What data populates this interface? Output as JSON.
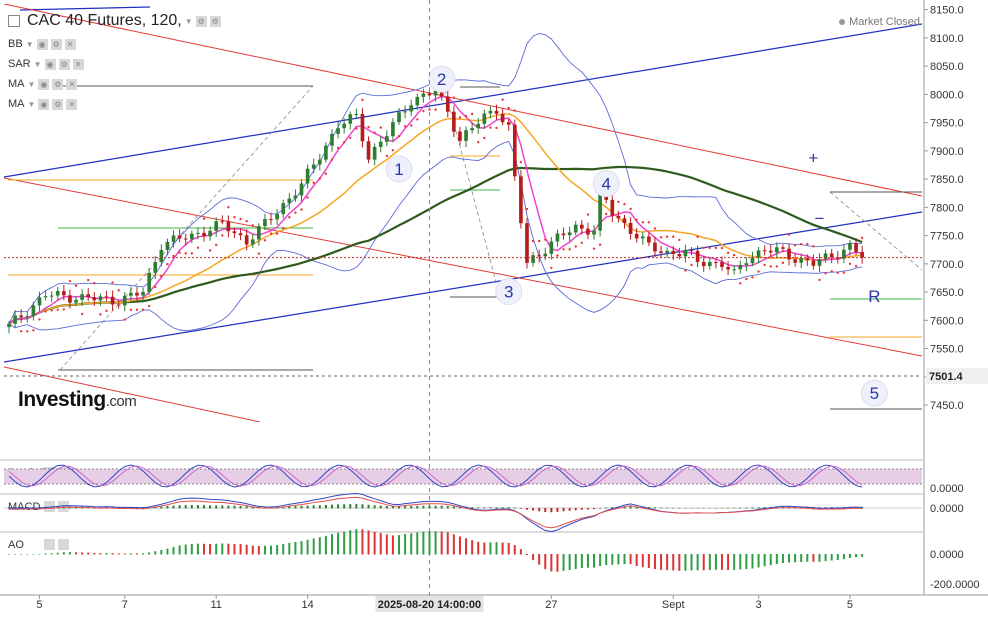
{
  "header": {
    "title": "CAC 40 Futures, 120,",
    "status": "Market Closed",
    "indicators": [
      "BB",
      "SAR",
      "MA",
      "MA"
    ]
  },
  "logo": {
    "main": "Investing",
    "suffix": ".com"
  },
  "colors": {
    "up_candle": "#2e7d32",
    "down_candle": "#b71c1c",
    "channel_blue": "#1f2fbf",
    "channel_red": "#e53935",
    "bollinger": "#5b6bd6",
    "sar": "#e53935",
    "ma_fast": "#ee44cc",
    "ma_mid": "#f5a623",
    "ma_slow": "#2e5a1e",
    "stoch_band": "#e6cfe6",
    "price_line": "#c62828"
  },
  "chart_data": [
    {
      "type": "candlestick",
      "title": "CAC 40 Futures, 120,",
      "ylim": [
        7420,
        8160
      ],
      "y_ticks": [
        "8150.0",
        "8100.0",
        "8050.0",
        "8000.0",
        "7950.0",
        "7900.0",
        "7850.0",
        "7800.0",
        "7750.0",
        "7700.0",
        "7650.0",
        "7600.0",
        "7550.0",
        "7500.0",
        "7450.0"
      ],
      "y_tick_values": [
        8150,
        8100,
        8050,
        8000,
        7950,
        7900,
        7850,
        7800,
        7750,
        7700,
        7650,
        7600,
        7550,
        7500,
        7450
      ],
      "price_label": "7501.4",
      "price_label_value": 7501.4,
      "last_price": 7711,
      "x_ticks": [
        "5",
        "7",
        "11",
        "14",
        "2025-08-20 14:00:00",
        "27",
        "Sept",
        "3",
        "5"
      ],
      "x_tick_bars": [
        5,
        19,
        34,
        49,
        69,
        89,
        109,
        123,
        138
      ],
      "crosshair_label": "2025-08-20 14:00:00",
      "crosshair_bar": 69,
      "wave_labels": [
        {
          "text": "1",
          "bar": 64,
          "price": 7868
        },
        {
          "text": "2",
          "bar": 71,
          "price": 8027
        },
        {
          "text": "3",
          "bar": 82,
          "price": 7651
        },
        {
          "text": "4",
          "bar": 98,
          "price": 7842
        },
        {
          "text": "5",
          "bar": 142,
          "price": 7471
        },
        {
          "text": "+",
          "bar": 132,
          "price": 7888
        },
        {
          "text": "−",
          "bar": 133,
          "price": 7781
        },
        {
          "text": "R",
          "bar": 142,
          "price": 7643
        }
      ],
      "anchors": [
        {
          "bar": 0,
          "price": 7590
        },
        {
          "bar": 6,
          "price": 7645
        },
        {
          "bar": 12,
          "price": 7640
        },
        {
          "bar": 18,
          "price": 7635
        },
        {
          "bar": 22,
          "price": 7650
        },
        {
          "bar": 25,
          "price": 7735
        },
        {
          "bar": 30,
          "price": 7750
        },
        {
          "bar": 35,
          "price": 7770
        },
        {
          "bar": 39,
          "price": 7740
        },
        {
          "bar": 42,
          "price": 7770
        },
        {
          "bar": 48,
          "price": 7840
        },
        {
          "bar": 54,
          "price": 7945
        },
        {
          "bar": 57,
          "price": 7960
        },
        {
          "bar": 59,
          "price": 7890
        },
        {
          "bar": 62,
          "price": 7930
        },
        {
          "bar": 66,
          "price": 7990
        },
        {
          "bar": 70,
          "price": 8005
        },
        {
          "bar": 72,
          "price": 7970
        },
        {
          "bar": 74,
          "price": 7920
        },
        {
          "bar": 78,
          "price": 7960
        },
        {
          "bar": 80,
          "price": 7975
        },
        {
          "bar": 82,
          "price": 7940
        },
        {
          "bar": 83,
          "price": 7850
        },
        {
          "bar": 85,
          "price": 7700
        },
        {
          "bar": 86,
          "price": 7710
        },
        {
          "bar": 90,
          "price": 7745
        },
        {
          "bar": 93,
          "price": 7765
        },
        {
          "bar": 96,
          "price": 7760
        },
        {
          "bar": 97,
          "price": 7830
        },
        {
          "bar": 99,
          "price": 7790
        },
        {
          "bar": 102,
          "price": 7760
        },
        {
          "bar": 105,
          "price": 7730
        },
        {
          "bar": 108,
          "price": 7720
        },
        {
          "bar": 111,
          "price": 7720
        },
        {
          "bar": 113,
          "price": 7705
        },
        {
          "bar": 117,
          "price": 7700
        },
        {
          "bar": 119,
          "price": 7680
        },
        {
          "bar": 121,
          "price": 7710
        },
        {
          "bar": 124,
          "price": 7725
        },
        {
          "bar": 127,
          "price": 7720
        },
        {
          "bar": 129,
          "price": 7710
        },
        {
          "bar": 132,
          "price": 7700
        },
        {
          "bar": 135,
          "price": 7715
        },
        {
          "bar": 138,
          "price": 7730
        },
        {
          "bar": 139,
          "price": 7722
        },
        {
          "bar": 140,
          "price": 7711
        }
      ],
      "sub_panels": [
        {
          "name": "Stoch RSI",
          "value_label": "0.0000",
          "value": 0
        },
        {
          "name": "MACD",
          "value_label": "0.0000",
          "value": 0
        },
        {
          "name": "AO",
          "value_labels": [
            "0.0000",
            "-200.0000"
          ],
          "values": [
            0,
            -200
          ]
        }
      ]
    }
  ]
}
